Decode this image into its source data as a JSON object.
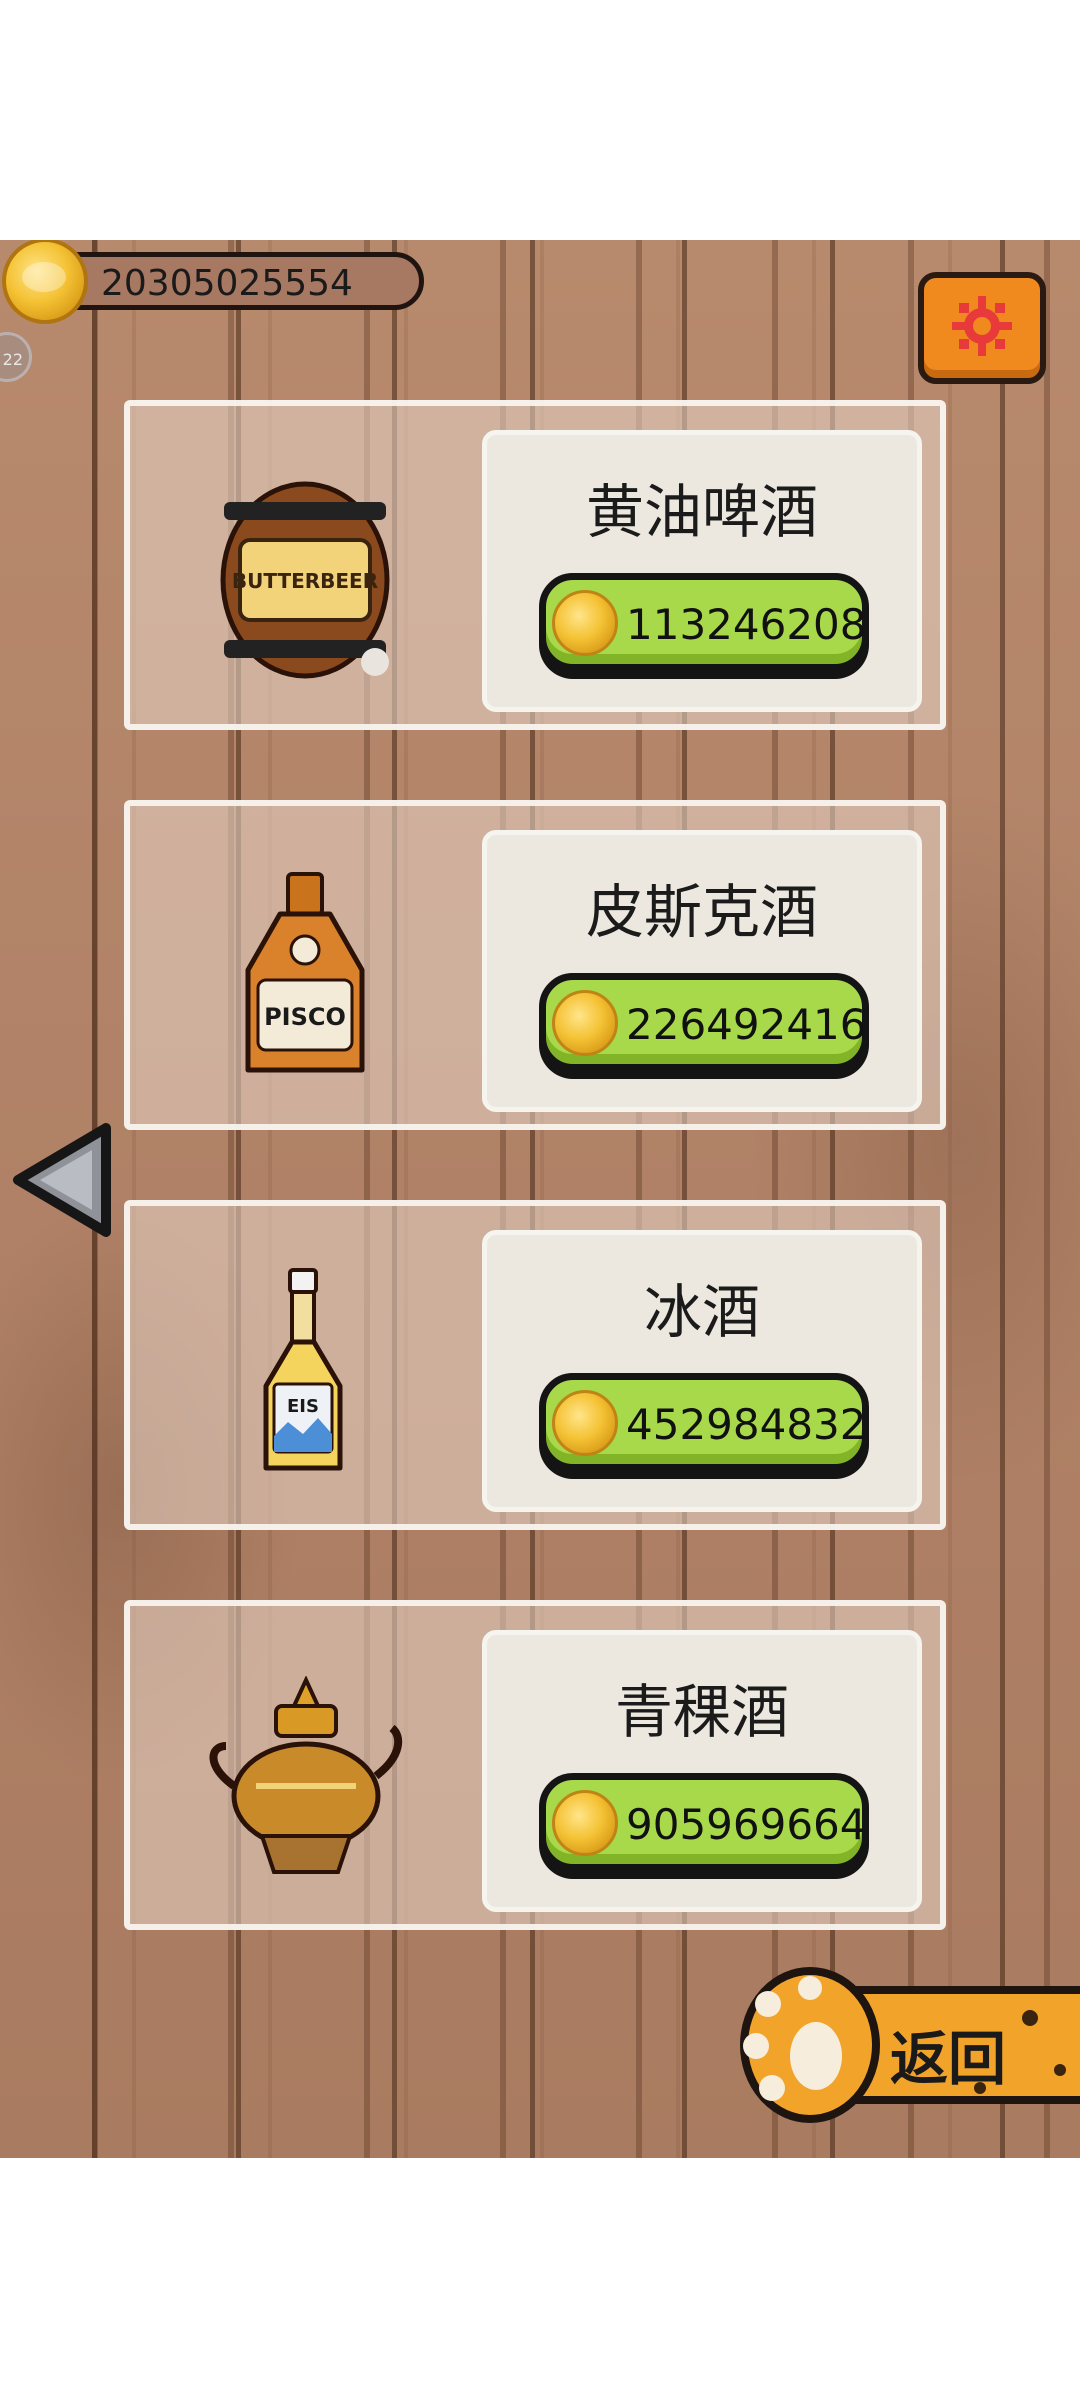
{
  "top_bar": {
    "coin_balance": "20305025554",
    "side_badge": "22"
  },
  "shop_items": [
    {
      "name": "黄油啤酒",
      "price": "113246208",
      "icon": "butterbeer-barrel-icon"
    },
    {
      "name": "皮斯克酒",
      "price": "226492416",
      "icon": "pisco-bottle-icon"
    },
    {
      "name": "冰酒",
      "price": "452984832",
      "icon": "ice-wine-bottle-icon"
    },
    {
      "name": "青稞酒",
      "price": "905969664",
      "icon": "barley-wine-teapot-icon"
    }
  ],
  "icon_labels": {
    "butterbeer": "BUTTERBEER",
    "pisco": "PISCO",
    "ice_wine": "EIS"
  },
  "back_button": {
    "label": "返回"
  },
  "colors": {
    "price_button": "#a7d94a",
    "settings_button": "#f08a1e",
    "coin_gold": "#f4c234",
    "wood_bg": "#b08166"
  }
}
